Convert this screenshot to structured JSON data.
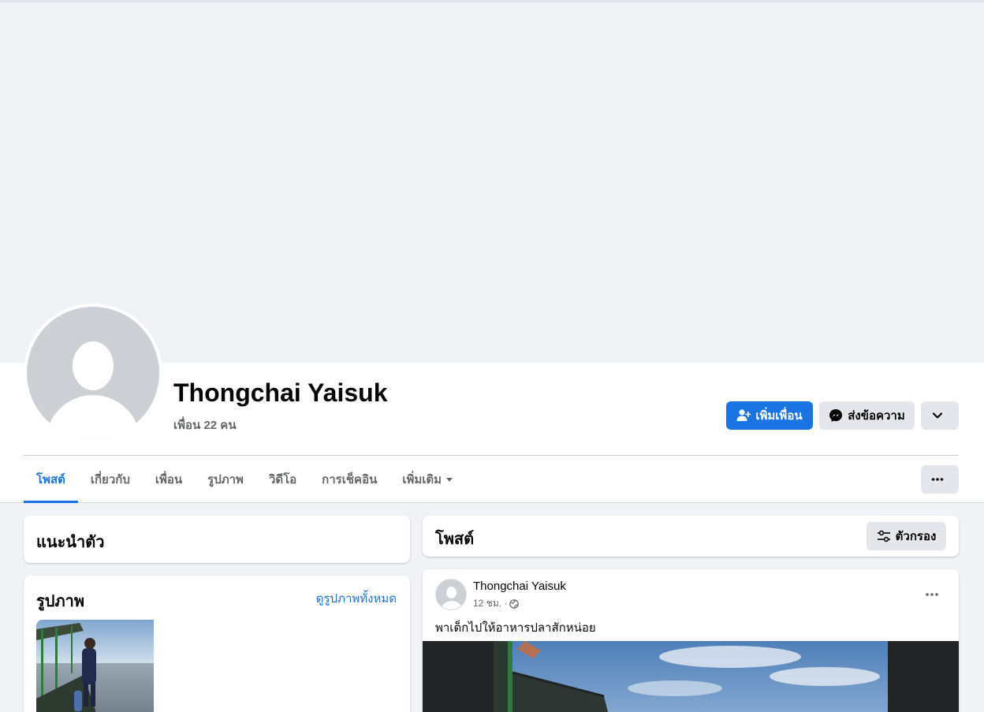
{
  "profile": {
    "name": "Thongchai Yaisuk",
    "friends_count": "เพื่อน 22 คน"
  },
  "actions": {
    "add_friend": "เพิ่มเพื่อน",
    "message": "ส่งข้อความ"
  },
  "tabs": [
    {
      "label": "โพสต์",
      "active": true
    },
    {
      "label": "เกี่ยวกับ"
    },
    {
      "label": "เพื่อน"
    },
    {
      "label": "รูปภาพ"
    },
    {
      "label": "วิดีโอ"
    },
    {
      "label": "การเช็คอิน"
    },
    {
      "label": "เพิ่มเติม"
    }
  ],
  "intro": {
    "title": "แนะนำตัว"
  },
  "photos": {
    "title": "รูปภาพ",
    "see_all": "ดูรูปภาพทั้งหมด"
  },
  "posts": {
    "title": "โพสต์",
    "filter_label": "ตัวกรอง"
  },
  "post": {
    "author": "Thongchai Yaisuk",
    "time": "12 ชม. ·",
    "text": "พาเด็กไปให้อาหารปลาสักหน่อย"
  },
  "colors": {
    "accent": "#1b74e4",
    "link": "#216fdb",
    "background": "#f0f2f5",
    "secondary_button": "#e4e6eb"
  },
  "icons": {
    "add_friend": "add-person-icon",
    "message": "messenger-icon",
    "chevron": "chevron-down-icon",
    "more": "more-dots-icon",
    "filter": "filter-sliders-icon",
    "audience": "globe-icon"
  }
}
